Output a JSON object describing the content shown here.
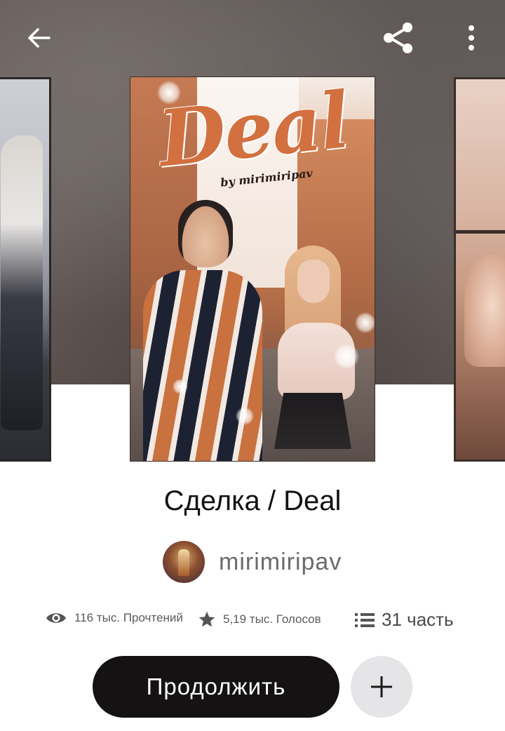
{
  "topbar": {
    "back_icon": "arrow-left-icon",
    "share_icon": "share-icon",
    "more_icon": "more-vertical-icon"
  },
  "cover": {
    "title_text": "Deal",
    "byline_text": "by mirimiripav",
    "accent_color": "#d2703f"
  },
  "story": {
    "title": "Сделка / Deal",
    "author": "mirimiripav"
  },
  "stats": {
    "reads": "116 тыс. Прочтений",
    "votes": "5,19 тыс. Голосов",
    "parts": "31 часть"
  },
  "actions": {
    "continue_label": "Продолжить",
    "add_icon": "plus-icon"
  }
}
